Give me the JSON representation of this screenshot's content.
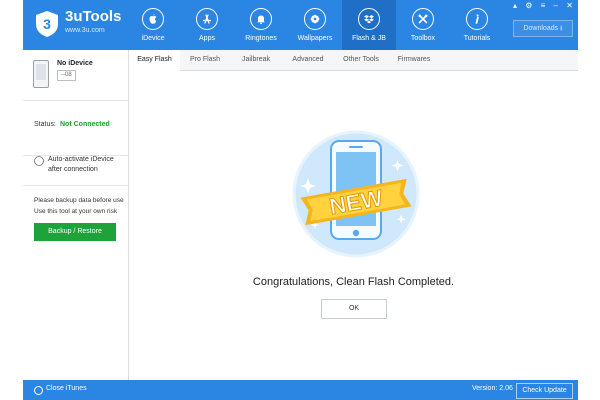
{
  "brand": {
    "name": "3uTools",
    "url": "www.3u.com",
    "logo_glyph": "3"
  },
  "nav": [
    {
      "label": "iDevice",
      "icon": "apple-icon",
      "active": false
    },
    {
      "label": "Apps",
      "icon": "app-store-icon",
      "active": false
    },
    {
      "label": "Ringtones",
      "icon": "bell-icon",
      "active": false
    },
    {
      "label": "Wallpapers",
      "icon": "flower-icon",
      "active": false
    },
    {
      "label": "Flash & JB",
      "icon": "dropbox-icon",
      "active": true
    },
    {
      "label": "Toolbox",
      "icon": "tools-icon",
      "active": false
    },
    {
      "label": "Tutorials",
      "icon": "info-icon",
      "active": false
    }
  ],
  "window": {
    "controls": "▴ ⚙ ≡ – ✕",
    "downloads_label": "Downloads ⭳"
  },
  "device": {
    "name": "No iDevice",
    "version": "--08"
  },
  "status": {
    "label": "Status:",
    "value": "Not Connected"
  },
  "auto_activate": {
    "label": "Auto-activate iDevice after connection"
  },
  "backup": {
    "note": "Please backup data before use Use this tool at your own risk",
    "button": "Backup / Restore"
  },
  "tabs": [
    "Easy Flash",
    "Pro Flash",
    "Jailbreak",
    "Advanced",
    "Other Tools",
    "Firmwares"
  ],
  "active_tab": "Easy Flash",
  "main": {
    "badge_text": "NEW",
    "message": "Congratulations, Clean Flash Completed.",
    "ok_label": "OK"
  },
  "footer": {
    "close_itunes": "Close iTunes",
    "version": "Version: 2.06",
    "check_update": "Check Update"
  },
  "colors": {
    "header_blue": "#2b86e3",
    "active_nav": "#1f6fc7",
    "success_green": "#1ca12b",
    "button_green": "#1ea23a"
  }
}
